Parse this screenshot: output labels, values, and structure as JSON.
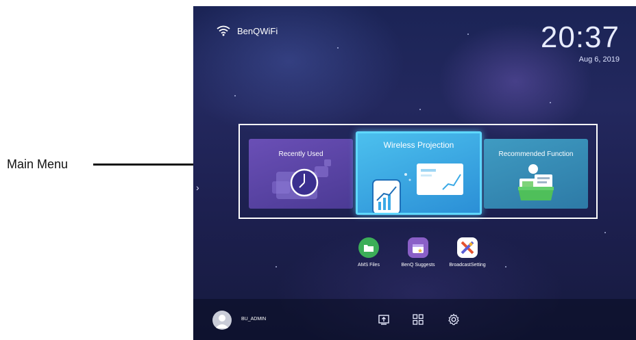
{
  "callout": {
    "label": "Main Menu"
  },
  "status": {
    "wifi_name": "BenQWiFi",
    "time": "20:37",
    "date": "Aug 6, 2019"
  },
  "side_arrow": "›",
  "main_menu": {
    "cards": [
      {
        "title": "Recently Used",
        "icon": "clock-icon",
        "color": "#5a44a8"
      },
      {
        "title": "Wireless Projection",
        "icon": "phone-projection-icon",
        "color": "#3aa9e6",
        "selected": true
      },
      {
        "title": "Recommended Function",
        "icon": "gift-box-icon",
        "color": "#358bb6"
      }
    ]
  },
  "apps": [
    {
      "label": "AMS Files",
      "icon": "folder-icon",
      "color": "#3cae58"
    },
    {
      "label": "BenQ Suggests",
      "icon": "shopping-bag-icon",
      "color": "#8a5fc7"
    },
    {
      "label": "BroadcastSetting",
      "icon": "broadcast-icon",
      "color": "#ffffff"
    }
  ],
  "bottom_bar": {
    "user": "BU_ADMIN",
    "icons": [
      "source-input-icon",
      "apps-grid-icon",
      "settings-gear-icon"
    ]
  }
}
